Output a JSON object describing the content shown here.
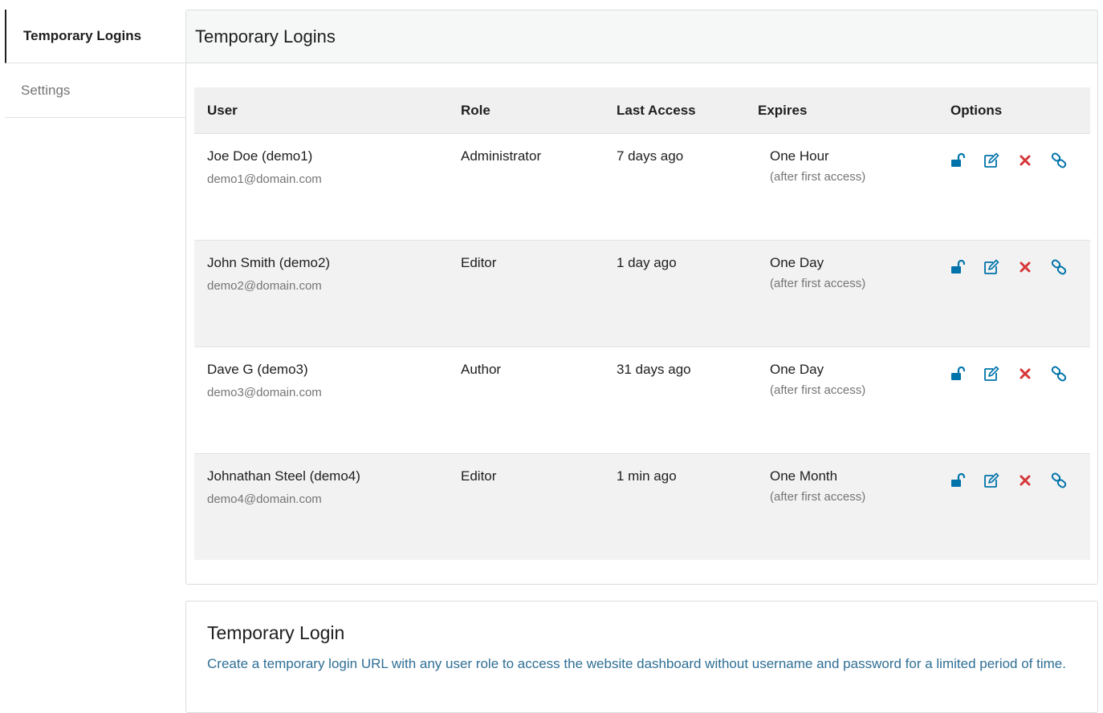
{
  "sidebar": {
    "items": [
      {
        "label": "Temporary Logins",
        "active": true
      },
      {
        "label": "Settings",
        "active": false
      }
    ]
  },
  "panel": {
    "title": "Temporary Logins",
    "columns": [
      "User",
      "Role",
      "Last Access",
      "Expires",
      "Options"
    ],
    "rows": [
      {
        "name": "Joe Doe (demo1)",
        "email": "demo1@domain.com",
        "role": "Administrator",
        "last_access": "7 days ago",
        "expires": "One Hour",
        "expires_note": "(after first access)"
      },
      {
        "name": "John Smith (demo2)",
        "email": "demo2@domain.com",
        "role": "Editor",
        "last_access": "1 day ago",
        "expires": "One Day",
        "expires_note": "(after first access)"
      },
      {
        "name": "Dave G (demo3)",
        "email": "demo3@domain.com",
        "role": "Author",
        "last_access": "31 days ago",
        "expires": "One Day",
        "expires_note": "(after first access)"
      },
      {
        "name": "Johnathan Steel (demo4)",
        "email": "demo4@domain.com",
        "role": "Editor",
        "last_access": "1 min ago",
        "expires": "One Month",
        "expires_note": "(after first access)"
      }
    ],
    "option_icons": [
      "unlock-icon",
      "edit-icon",
      "delete-icon",
      "link-icon"
    ]
  },
  "create": {
    "title": "Temporary Login",
    "description": "Create a temporary login URL with any user role to access the website dashboard without username and password for a limited period of time."
  },
  "colors": {
    "icon_blue": "#0073aa",
    "delete_red": "#d63638",
    "link_text": "#2f6f95"
  }
}
